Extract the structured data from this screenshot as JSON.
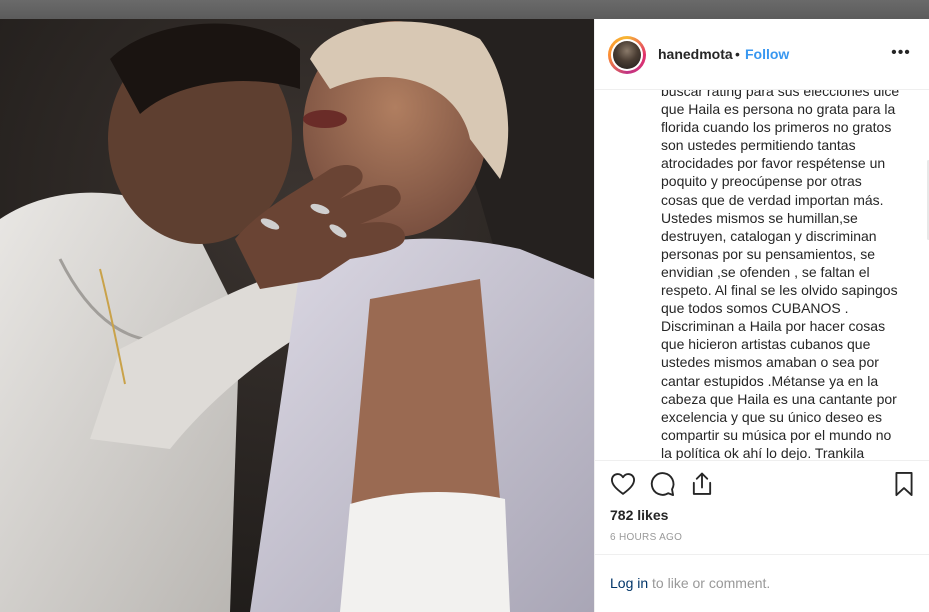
{
  "post": {
    "username": "hanedmota",
    "separator": "•",
    "follow_label": "Follow",
    "more_label": "•••",
    "caption_lines": [
      "buscar rating para sus elecciones dice",
      "que Haila es persona no grata para la",
      "florida cuando los primeros no gratos",
      "son ustedes permitiendo tantas",
      "atrocidades por favor respétense un",
      "poquito y preocúpense por otras",
      "cosas que de verdad importan más.",
      "Ustedes mismos se humillan,se",
      "destruyen, catalogan y discriminan",
      "personas por su pensamientos, se",
      "envidian ,se ofenden , se faltan el",
      "respeto. Al final se les olvido sapingos",
      "que todos somos CUBANOS .",
      "Discriminan a Haila por hacer cosas",
      "que hicieron artistas cubanos que",
      "ustedes mismos amaban o sea por",
      "cantar estupidos .Métanse ya en la",
      "cabeza que Haila es una cantante por",
      "excelencia y que su único deseo es",
      "compartir su música por el mundo no",
      "la política ok ahí lo dejo. Trankila"
    ],
    "likes": "782 likes",
    "timestamp": "6 HOURS AGO",
    "login_link": "Log in",
    "login_rest": " to like or comment."
  },
  "icons": {
    "like": "heart-icon",
    "comment": "comment-icon",
    "share": "share-icon",
    "save": "bookmark-icon"
  },
  "colors": {
    "follow": "#3897f0",
    "text": "#262626",
    "muted": "#999999",
    "link": "#003569",
    "border": "#efefef"
  }
}
